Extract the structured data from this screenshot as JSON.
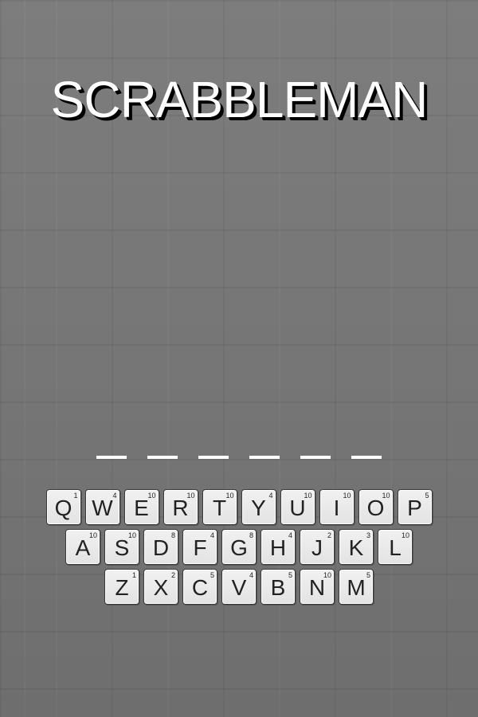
{
  "title": "SCRABBLEMAN",
  "word": {
    "slots": [
      "",
      "",
      "",
      "",
      "",
      ""
    ]
  },
  "keyboard": {
    "rows": [
      [
        {
          "letter": "Q",
          "score": "1"
        },
        {
          "letter": "W",
          "score": "4"
        },
        {
          "letter": "E",
          "score": "10"
        },
        {
          "letter": "R",
          "score": "10"
        },
        {
          "letter": "T",
          "score": "10"
        },
        {
          "letter": "Y",
          "score": "4"
        },
        {
          "letter": "U",
          "score": "10"
        },
        {
          "letter": "I",
          "score": "10"
        },
        {
          "letter": "O",
          "score": "10"
        },
        {
          "letter": "P",
          "score": "5"
        }
      ],
      [
        {
          "letter": "A",
          "score": "10"
        },
        {
          "letter": "S",
          "score": "10"
        },
        {
          "letter": "D",
          "score": "8"
        },
        {
          "letter": "F",
          "score": "4"
        },
        {
          "letter": "G",
          "score": "8"
        },
        {
          "letter": "H",
          "score": "4"
        },
        {
          "letter": "J",
          "score": "2"
        },
        {
          "letter": "K",
          "score": "3"
        },
        {
          "letter": "L",
          "score": "10"
        }
      ],
      [
        {
          "letter": "Z",
          "score": "1"
        },
        {
          "letter": "X",
          "score": "2"
        },
        {
          "letter": "C",
          "score": "5"
        },
        {
          "letter": "V",
          "score": "4"
        },
        {
          "letter": "B",
          "score": "5"
        },
        {
          "letter": "N",
          "score": "10"
        },
        {
          "letter": "M",
          "score": "5"
        }
      ]
    ]
  }
}
